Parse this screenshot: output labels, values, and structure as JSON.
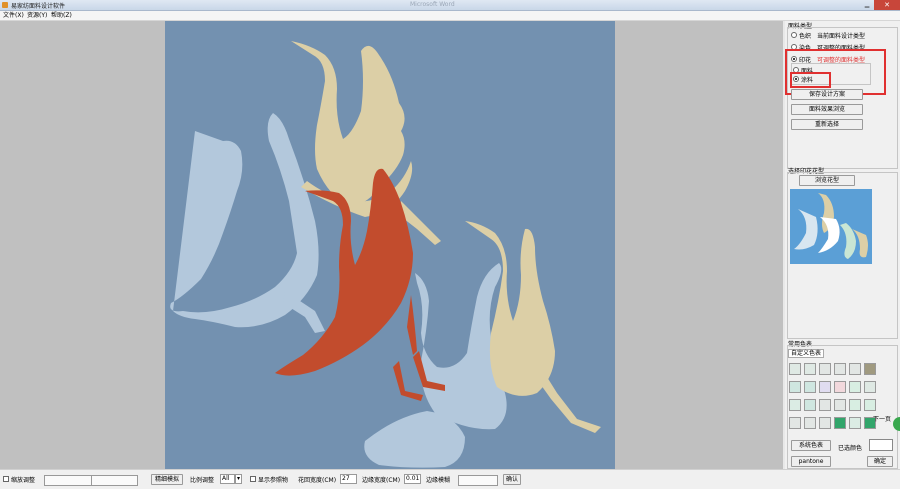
{
  "window": {
    "title": "易家纺面料设计软件",
    "background_title": "Microsoft Word",
    "close_label": "✕",
    "minimize_label": "▁"
  },
  "menu": [
    "文件(X)",
    "资源(Y)",
    "帮助(Z)"
  ],
  "fabric_type": {
    "title": "面料类型",
    "options": [
      {
        "label": "色织",
        "note": "当前面料设计类型",
        "checked": false
      },
      {
        "label": "染色",
        "note": "可调整的面料类型",
        "checked": false
      },
      {
        "label": "印花",
        "note": "可调整的面料类型",
        "checked": true
      }
    ],
    "sub_options": [
      {
        "label": "面料",
        "checked": false
      },
      {
        "label": "涂料",
        "checked": true
      }
    ]
  },
  "buttons": {
    "save_design": "保存设计方案",
    "preview_effect": "面料效果浏览",
    "reselect": "重新选择",
    "browse_pattern": "浏览花型",
    "system_colors": "系统色表",
    "pantone": "pantone",
    "confirm": "确定",
    "next_page": "下一页",
    "simulate": "模拟",
    "confirm_status": "确认"
  },
  "pattern_group": {
    "title": "选择印花花型"
  },
  "colors_group": {
    "title": "常用色表",
    "tab": "自定义色表",
    "selected_label": "已选颜色",
    "swatches": [
      "#dfe9e4",
      "#dfe9e4",
      "#e2e6e4",
      "#e2e6e4",
      "#e2e6e4",
      "#a09a80",
      "#cfe6e0",
      "#cfe6e0",
      "#e0dcf0",
      "#f2d8dc",
      "#d8eee2",
      "#dfe9e4",
      "#dbece4",
      "#cfe6e0",
      "#e2e6e4",
      "#e2e6e4",
      "#d8eee2",
      "#d8eee2",
      "#e2e6e4",
      "#e2e6e4",
      "#e2e6e4",
      "#33a56b",
      "#dbece4",
      "#33a56b"
    ]
  },
  "statusbar": {
    "zoom_label": "缩放调整",
    "fine_tune": "精细模拟",
    "ratio_label": "比例调整",
    "ratio_value": "All",
    "show_reference": "显示参照物",
    "pattern_width_label": "花回宽度(CM)",
    "pattern_width_value": "27",
    "border_width_label": "边缘宽度(CM)",
    "border_width_value": "0.01",
    "border_blur_label": "边缘模糊"
  },
  "colors": {
    "artwork_bg": "#7391b0",
    "crane_blue": "#b3c8dc",
    "crane_cream": "#dccfa6",
    "crane_red": "#c24c2d",
    "highlight_red": "#e03030"
  }
}
